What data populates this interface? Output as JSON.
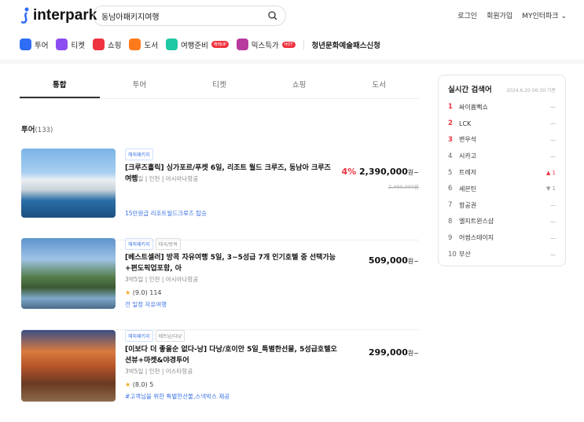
{
  "header": {
    "logo": "interpark",
    "search_value": "동남아패키지여행",
    "links": [
      "로그인",
      "회원가입",
      "MY인터파크"
    ]
  },
  "nav": [
    {
      "label": "투어",
      "color": "#2f6df6"
    },
    {
      "label": "티켓",
      "color": "#8b4cf0"
    },
    {
      "label": "쇼핑",
      "color": "#ef3340"
    },
    {
      "label": "도서",
      "color": "#ff7a1a"
    },
    {
      "label": "여행준비",
      "color": "#1fc8a4",
      "badge": "혜택UP"
    },
    {
      "label": "믹스득가",
      "color": "#b83a9e",
      "badge": "HOT"
    },
    {
      "label": "청년문화예술패스신청"
    }
  ],
  "tabs": [
    "통합",
    "투어",
    "티켓",
    "쇼핑",
    "도서"
  ],
  "section": {
    "title": "투어",
    "count": "(133)"
  },
  "items": [
    {
      "tags": [
        "해외패키지"
      ],
      "title": "[크루즈홀릭] 싱가포르/푸켓 6일, 리조트 월드 크루즈, 동남아 크루즈 여행",
      "meta": "4박6일 | 인천 | 아시아나항공",
      "promo": "15만원급 리조트월드크루즈 탑승",
      "discount": "4%",
      "price": "2,390,000",
      "unit": "원~",
      "original": "2,490,000원"
    },
    {
      "tags": [
        "해외패키지",
        "태국/방콕"
      ],
      "title": "[베스트셀러] 방콕 자유여행 5일, 3~5성급 7개 인기호텔 중 선택가능+편도픽업포함, 아",
      "meta": "3박5일 | 인천 | 아시아나항공",
      "rating": "(9.0) 114",
      "promo": "전 일정 자유여행",
      "price": "509,000",
      "unit": "원~"
    },
    {
      "tags": [
        "해외패키지",
        "베트남/다낭"
      ],
      "title": "[이보다 더 좋을순 없다-낭] 다낭/호이안 5일_특별한선물, 5성급호텔오션뷰+마켓&야경투어",
      "meta": "3박5일 | 인천 | 이스타항공",
      "rating": "(8.0) 5",
      "promo": "#고객님을 위한 특별한선물,스낵박스 제공",
      "price": "299,000",
      "unit": "원~"
    }
  ],
  "ranking": {
    "title": "실시간 검색어",
    "date": "2024.6.20 06:30 기준",
    "items": [
      {
        "rank": "1",
        "word": "싸이흠뻑쇼",
        "change": "—"
      },
      {
        "rank": "2",
        "word": "LCK",
        "change": "—"
      },
      {
        "rank": "3",
        "word": "변우석",
        "change": "—"
      },
      {
        "rank": "4",
        "word": "시카고",
        "change": "—"
      },
      {
        "rank": "5",
        "word": "트레저",
        "change": "▲ 1"
      },
      {
        "rank": "6",
        "word": "세븐틴",
        "change": "▼ 1"
      },
      {
        "rank": "7",
        "word": "항공권",
        "change": "—"
      },
      {
        "rank": "8",
        "word": "엘지트윈스샵",
        "change": "—"
      },
      {
        "rank": "9",
        "word": "어썸스테이지",
        "change": "—"
      },
      {
        "rank": "10",
        "word": "부산",
        "change": "—"
      }
    ]
  }
}
